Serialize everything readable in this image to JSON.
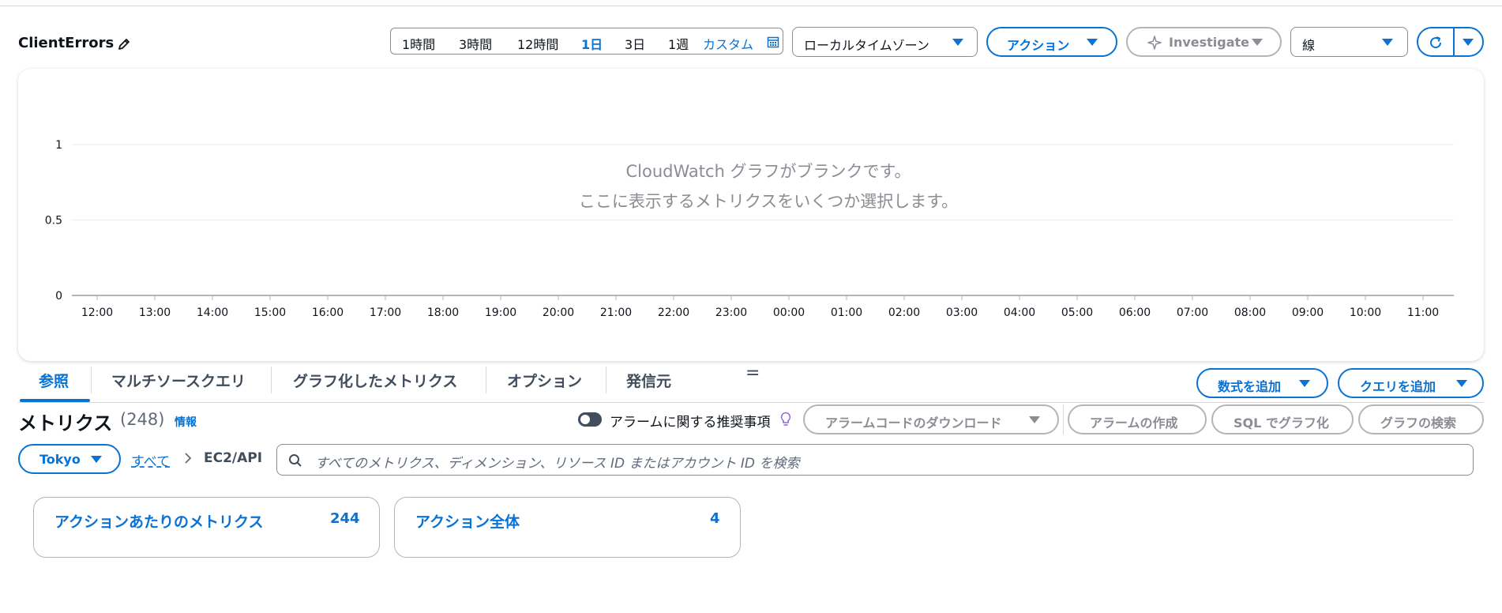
{
  "header": {
    "title": "ClientErrors"
  },
  "time_range": {
    "options": [
      "1時間",
      "3時間",
      "12時間",
      "1日",
      "3日",
      "1週",
      "カスタム"
    ],
    "selected": "1日"
  },
  "timezone": {
    "label": "ローカルタイムゾーン"
  },
  "actions": {
    "label": "アクション"
  },
  "investigate": {
    "label": "Investigate"
  },
  "chart_type": {
    "label": "線"
  },
  "chart_data": {
    "type": "line",
    "title": "",
    "xlabel": "",
    "ylabel": "",
    "ylim": [
      0,
      1
    ],
    "y_ticks": [
      "1",
      "0.5",
      "0"
    ],
    "x_ticks": [
      "12:00",
      "13:00",
      "14:00",
      "15:00",
      "16:00",
      "17:00",
      "18:00",
      "19:00",
      "20:00",
      "21:00",
      "22:00",
      "23:00",
      "00:00",
      "01:00",
      "02:00",
      "03:00",
      "04:00",
      "05:00",
      "06:00",
      "07:00",
      "08:00",
      "09:00",
      "10:00",
      "11:00"
    ],
    "series": [],
    "grid": true
  },
  "empty_state": {
    "line1": "CloudWatch グラフがブランクです。",
    "line2": "ここに表示するメトリクスをいくつか選択します。"
  },
  "tabs": [
    {
      "label": "参照",
      "active": true
    },
    {
      "label": "マルチソースクエリ",
      "active": false
    },
    {
      "label": "グラフ化したメトリクス",
      "active": false
    },
    {
      "label": "オプション",
      "active": false
    },
    {
      "label": "発信元",
      "active": false
    }
  ],
  "add_formula": {
    "label": "数式を追加"
  },
  "add_query": {
    "label": "クエリを追加"
  },
  "metrics": {
    "title": "メトリクス",
    "count": "(248)",
    "info": "情報"
  },
  "alarm_toggle": {
    "label": "アラームに関する推奨事項",
    "checked": false
  },
  "buttons": {
    "download_alarm_code": "アラームコードのダウンロード",
    "create_alarm": "アラームの作成",
    "sql_graph": "SQL でグラフ化",
    "graph_search": "グラフの検索"
  },
  "region": {
    "label": "Tokyo"
  },
  "breadcrumb": {
    "all": "すべて",
    "current": "EC2/API"
  },
  "search": {
    "placeholder": "すべてのメトリクス、ディメンション、リソース ID またはアカウント ID を検索"
  },
  "cards": [
    {
      "label": "アクションあたりのメトリクス",
      "count": "244"
    },
    {
      "label": "アクション全体",
      "count": "4"
    }
  ],
  "colors": {
    "accent": "#0972d3",
    "disabled": "#8c8c94",
    "border": "#d5dbdb"
  }
}
